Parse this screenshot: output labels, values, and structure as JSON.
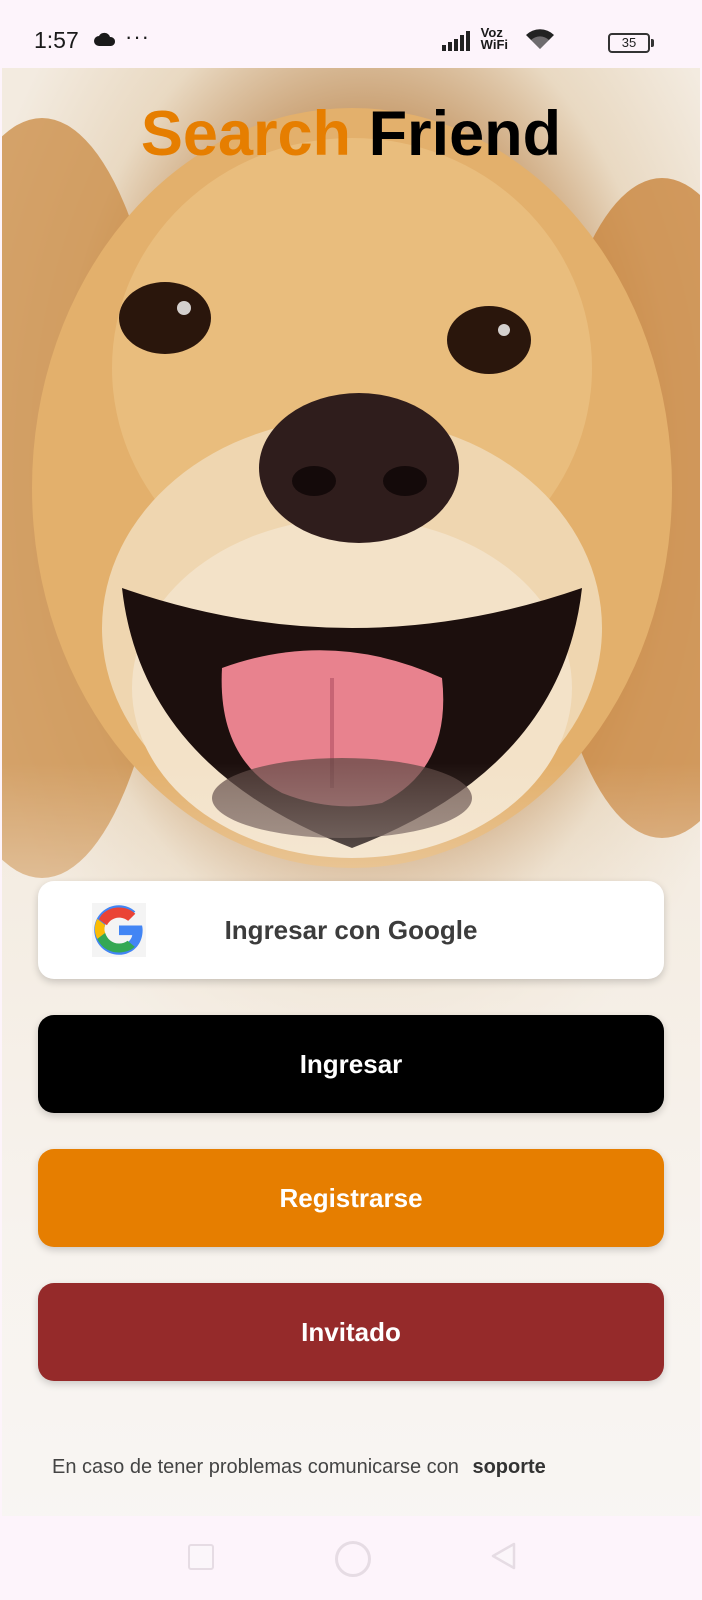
{
  "status_bar": {
    "time": "1:57",
    "dots": "···",
    "network_label_1": "Voz",
    "network_label_2": "WiFi",
    "battery": "35"
  },
  "app": {
    "title_part1": "Search",
    "title_part2": "Friend",
    "accent_color": "#e67e00"
  },
  "buttons": {
    "google": "Ingresar con Google",
    "login": "Ingresar",
    "register": "Registrarse",
    "guest": "Invitado"
  },
  "footer": {
    "support_text": "En caso de tener problemas comunicarse con",
    "support_link": "soporte"
  },
  "icons": {
    "cloud": "cloud-icon",
    "signal": "signal-icon",
    "wifi": "wifi-icon",
    "battery": "battery-icon",
    "google": "google-icon",
    "nav_recent": "square-icon",
    "nav_home": "circle-icon",
    "nav_back": "triangle-back-icon"
  }
}
